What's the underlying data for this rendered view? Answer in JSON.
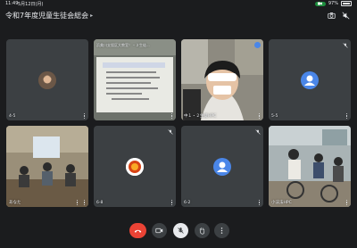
{
  "status_bar": {
    "time": "11:49",
    "date": "5月12日(月)",
    "battery": "97%"
  },
  "header": {
    "title": "令和7年度児童生徒会総会"
  },
  "tiles": [
    {
      "name": "4-5"
    },
    {
      "name": "浜美川支援区大教室！・２生徒..."
    },
    {
      "name": "中１・２生徒HPC"
    },
    {
      "name": "5-5"
    },
    {
      "name": "あなた"
    },
    {
      "name": "6-8"
    },
    {
      "name": "6-2"
    },
    {
      "name": "小法法HPC"
    }
  ],
  "colors": {
    "background": "#1b1c1e",
    "tile": "#3c4043",
    "leave_button": "#ea4335",
    "avatar_blue": "#4a86e8",
    "camera_indicator": "#1e8e3e"
  },
  "icons": [
    "video-camera-icon",
    "flip-camera-icon",
    "speaker-mute-icon",
    "mic-muted-icon",
    "end-call-icon",
    "raise-hand-icon",
    "more-vert-icon"
  ]
}
